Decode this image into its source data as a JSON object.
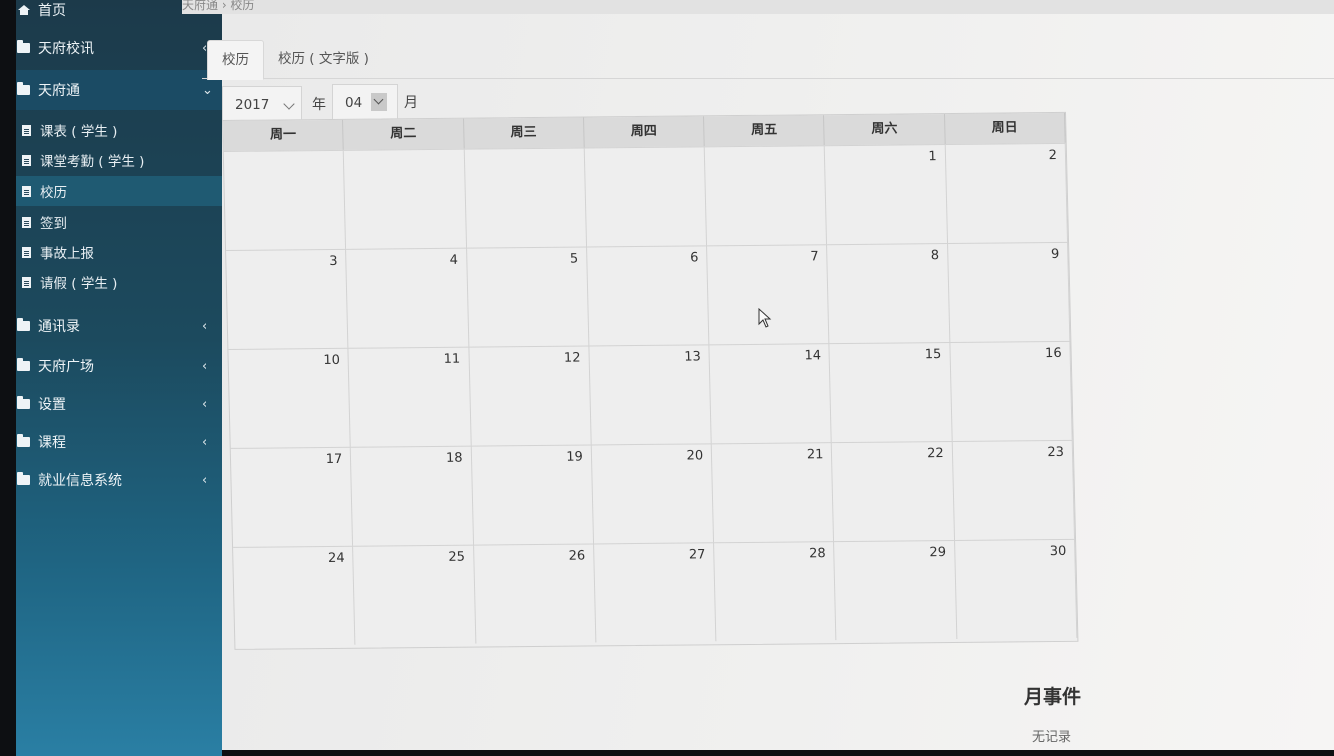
{
  "sidebar": {
    "home": "首页",
    "items": [
      {
        "label": "天府校讯"
      },
      {
        "label": "天府通"
      },
      {
        "label": "通讯录"
      },
      {
        "label": "天府广场"
      },
      {
        "label": "设置"
      },
      {
        "label": "课程"
      },
      {
        "label": "就业信息系统"
      }
    ],
    "sub_items": [
      {
        "label": "课表 ( 学生 )"
      },
      {
        "label": "课堂考勤 ( 学生 )"
      },
      {
        "label": "校历"
      },
      {
        "label": "签到"
      },
      {
        "label": "事故上报"
      },
      {
        "label": "请假 ( 学生 )"
      }
    ]
  },
  "breadcrumb": "天府通 › 校历",
  "tabs": [
    {
      "label": "校历",
      "active": true
    },
    {
      "label": "校历 ( 文字版 )",
      "active": false
    }
  ],
  "filters": {
    "year_value": "2017",
    "year_unit": "年",
    "month_value": "04",
    "month_unit": "月"
  },
  "calendar": {
    "weekdays": [
      "周一",
      "周二",
      "周三",
      "周四",
      "周五",
      "周六",
      "周日"
    ],
    "weeks": [
      [
        "",
        "",
        "",
        "",
        "",
        "1",
        "2"
      ],
      [
        "3",
        "4",
        "5",
        "6",
        "7",
        "8",
        "9"
      ],
      [
        "10",
        "11",
        "12",
        "13",
        "14",
        "15",
        "16"
      ],
      [
        "17",
        "18",
        "19",
        "20",
        "21",
        "22",
        "23"
      ],
      [
        "24",
        "25",
        "26",
        "27",
        "28",
        "29",
        "30"
      ]
    ]
  },
  "events": {
    "title": "月事件",
    "empty_text": "无记录"
  }
}
